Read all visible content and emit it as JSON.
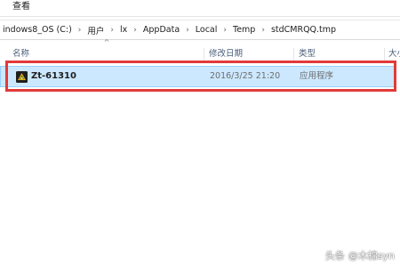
{
  "ribbon": {
    "view_tab": "查看"
  },
  "address_bar": {
    "crumbs": [
      "indows8_OS (C:)",
      "用户",
      "lx",
      "AppData",
      "Local",
      "Temp",
      "stdCMRQQ.tmp"
    ],
    "separator": "›"
  },
  "columns": {
    "sort_indicator": "^",
    "name": "名称",
    "date_modified": "修改日期",
    "type": "类型",
    "size": "大小"
  },
  "files": [
    {
      "name": "Zt-61310",
      "date_modified": "2016/3/25 21:20",
      "type": "应用程序",
      "icon": "application-icon"
    }
  ],
  "watermark": {
    "left": "头条",
    "right": "@木棉syn"
  },
  "colors": {
    "selection_bg": "#cce8ff",
    "highlight_border": "#e23a3a",
    "header_text": "#4c607a"
  }
}
